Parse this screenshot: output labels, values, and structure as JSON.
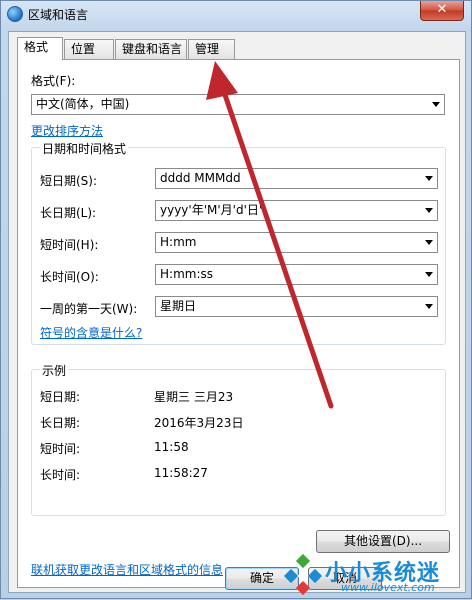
{
  "window": {
    "title": "区域和语言",
    "close_label": "✕"
  },
  "tabs": [
    {
      "label": "格式"
    },
    {
      "label": "位置"
    },
    {
      "label": "键盘和语言"
    },
    {
      "label": "管理"
    }
  ],
  "format": {
    "label": "格式(F):",
    "value": "中文(简体，中国)",
    "sort_link": "更改排序方法"
  },
  "datetime_group": {
    "title": "日期和时间格式",
    "rows": [
      {
        "label": "短日期(S):",
        "value": "dddd  MMMdd"
      },
      {
        "label": "长日期(L):",
        "value": "yyyy'年'M'月'd'日'"
      },
      {
        "label": "短时间(H):",
        "value": "H:mm"
      },
      {
        "label": "长时间(O):",
        "value": "H:mm:ss"
      },
      {
        "label": "一周的第一天(W):",
        "value": "星期日"
      }
    ],
    "symbol_link": "符号的含意是什么?"
  },
  "examples": {
    "title": "示例",
    "rows": [
      {
        "label": "短日期:",
        "value": "星期三  三月23"
      },
      {
        "label": "长日期:",
        "value": "2016年3月23日"
      },
      {
        "label": "短时间:",
        "value": "11:58"
      },
      {
        "label": "长时间:",
        "value": "11:58:27"
      }
    ]
  },
  "other_settings_button": "其他设置(D)...",
  "online_link": "联机获取更改语言和区域格式的信息",
  "footer": {
    "ok": "确定",
    "cancel": "取消"
  },
  "watermark": {
    "text": "小小系统迷",
    "url": "www.ilovext.com"
  },
  "colors": {
    "link": "#0066cc",
    "annotation_arrow": "#c0272d",
    "watermark": "#1a8bd6"
  }
}
